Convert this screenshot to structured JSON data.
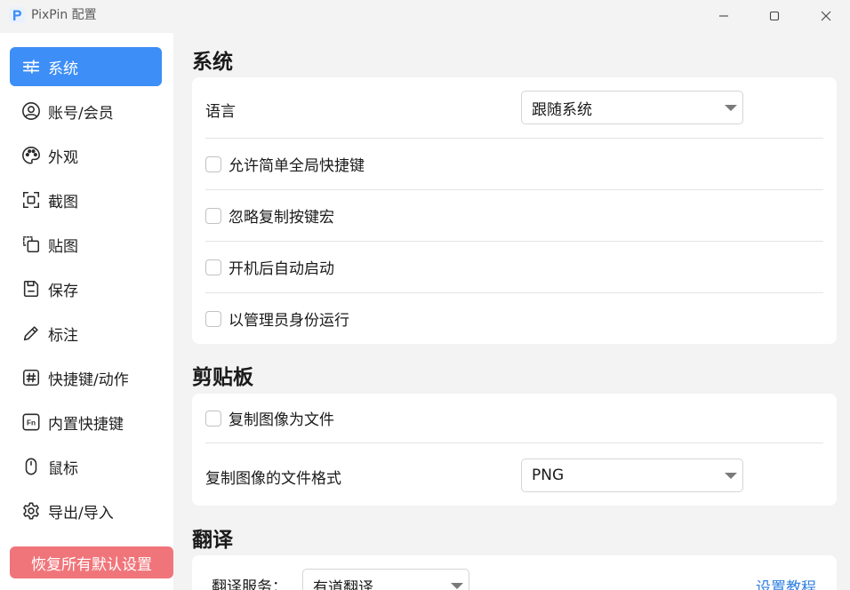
{
  "window": {
    "title": "PixPin 配置",
    "logo_letter": "P"
  },
  "sidebar": {
    "items": [
      {
        "label": "系统",
        "icon": "sliders-icon",
        "active": true
      },
      {
        "label": "账号/会员",
        "icon": "user-circle-icon",
        "active": false
      },
      {
        "label": "外观",
        "icon": "palette-icon",
        "active": false
      },
      {
        "label": "截图",
        "icon": "screenshot-frame-icon",
        "active": false
      },
      {
        "label": "贴图",
        "icon": "pin-image-icon",
        "active": false
      },
      {
        "label": "保存",
        "icon": "save-icon",
        "active": false
      },
      {
        "label": "标注",
        "icon": "pencil-icon",
        "active": false
      },
      {
        "label": "快捷键/动作",
        "icon": "hash-key-icon",
        "active": false
      },
      {
        "label": "内置快捷键",
        "icon": "fn-key-icon",
        "active": false
      },
      {
        "label": "鼠标",
        "icon": "mouse-icon",
        "active": false
      },
      {
        "label": "导出/导入",
        "icon": "gear-icon",
        "active": false
      }
    ],
    "reset_label": "恢复所有默认设置"
  },
  "system": {
    "title": "系统",
    "language_label": "语言",
    "language_value": "跟随系统",
    "options": [
      {
        "label": "允许简单全局快捷键",
        "checked": false
      },
      {
        "label": "忽略复制按键宏",
        "checked": false
      },
      {
        "label": "开机后自动启动",
        "checked": false
      },
      {
        "label": "以管理员身份运行",
        "checked": false
      }
    ]
  },
  "clipboard": {
    "title": "剪贴板",
    "copy_as_file_label": "复制图像为文件",
    "copy_as_file_checked": false,
    "format_label": "复制图像的文件格式",
    "format_value": "PNG"
  },
  "translate": {
    "title": "翻译",
    "service_label": "翻译服务：",
    "service_value": "有道翻译",
    "tutorial_link": "设置教程"
  },
  "colors": {
    "accent": "#3d8ef7",
    "reset": "#f0757a",
    "link": "#2f7fe0"
  }
}
